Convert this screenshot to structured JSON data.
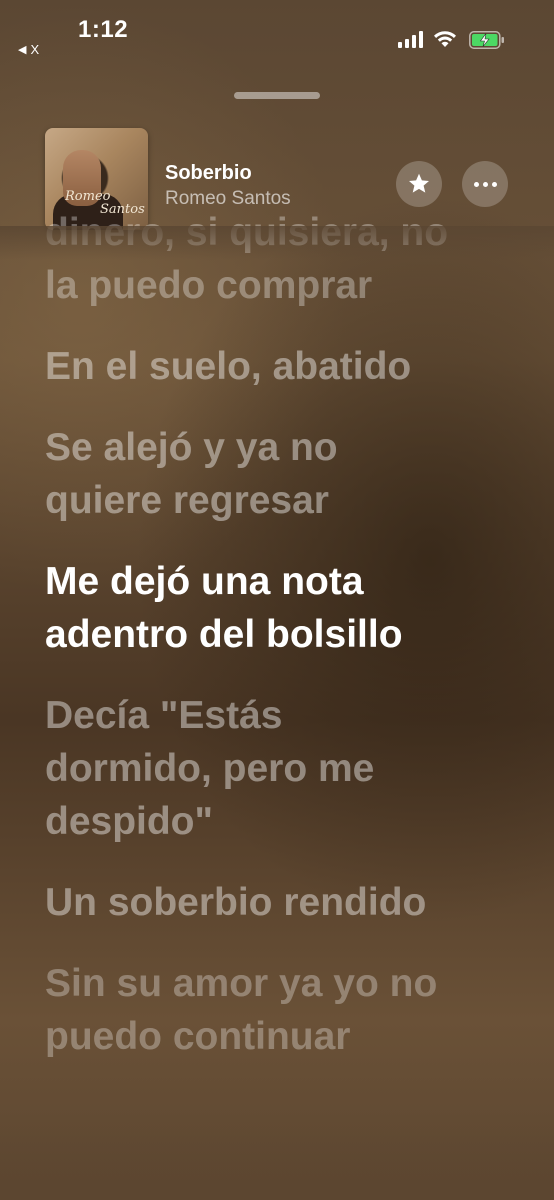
{
  "status_bar": {
    "time": "1:12",
    "back_app": "X",
    "battery": "charging"
  },
  "now_playing": {
    "title": "Soberbio",
    "artist": "Romeo Santos",
    "artwork_text": "Romeo Santos",
    "favorite_icon": "star-icon",
    "more_icon": "ellipsis-icon"
  },
  "lyrics": [
    {
      "text": "dinero, si quisiera, no\nla puedo comprar",
      "state": "past"
    },
    {
      "text": "En el suelo, abatido",
      "state": "past"
    },
    {
      "text": "Se alejó y ya no\nquiere regresar",
      "state": "past"
    },
    {
      "text": "Me dejó una nota\nadentro del bolsillo",
      "state": "current"
    },
    {
      "text": "Decía \"Estás\ndormido, pero me\ndespido\"",
      "state": "upcoming"
    },
    {
      "text": "Un soberbio rendido",
      "state": "upcoming"
    },
    {
      "text": "Sin su amor ya yo no\npuedo continuar",
      "state": "upcoming"
    }
  ],
  "colors": {
    "background": "#5b4733",
    "active_lyric": "#ffffff",
    "inactive_lyric": "rgba(255,255,255,0.42)",
    "battery_green": "#4cd964"
  }
}
